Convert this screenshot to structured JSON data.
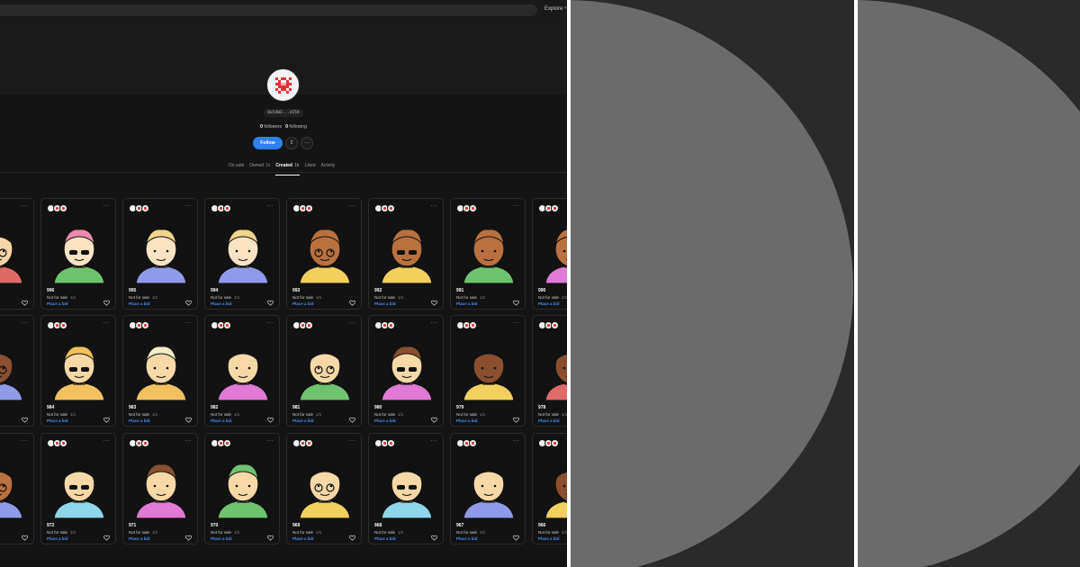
{
  "topbar": {
    "nav_explore": "Explore",
    "nav_more": "›"
  },
  "profile": {
    "address": "0x5403...d159",
    "followers_count": "0",
    "followers_label": "followers",
    "following_count": "0",
    "following_label": "following",
    "follow_label": "Follow",
    "share_glyph": "⇪",
    "more_glyph": "···"
  },
  "tabs": [
    {
      "label": "On sale",
      "count": ""
    },
    {
      "label": "Owned",
      "count": "1k"
    },
    {
      "label": "Created",
      "count": "1k"
    },
    {
      "label": "Liked",
      "count": ""
    },
    {
      "label": "Activity",
      "count": ""
    }
  ],
  "active_tab": "Created",
  "card_menu_glyph": "···",
  "card_sale_text": "Not for sale",
  "card_edition": "1/1",
  "card_bid_text": "Place a bid",
  "cards": [
    {
      "title": "",
      "skin": "#f5d6a8",
      "shirt": "#e06a6a",
      "hair": "#111111"
    },
    {
      "title": "996",
      "skin": "#fbe3c3",
      "shirt": "#6fc36e",
      "hair": "#f08ab0"
    },
    {
      "title": "995",
      "skin": "#fbe3c3",
      "shirt": "#8f9be8",
      "hair": "#f2d48a"
    },
    {
      "title": "994",
      "skin": "#fbe3c3",
      "shirt": "#8f9be8",
      "hair": "#f2d48a"
    },
    {
      "title": "993",
      "skin": "#b9713f",
      "shirt": "#f2d05e",
      "hair": "#b9713f"
    },
    {
      "title": "992",
      "skin": "#b9713f",
      "shirt": "#f2d05e",
      "hair": "#b9713f"
    },
    {
      "title": "991",
      "skin": "#b9713f",
      "shirt": "#6fc36e",
      "hair": "#b9713f"
    },
    {
      "title": "990",
      "skin": "#b9713f",
      "shirt": "#e07ad6",
      "hair": "#b9713f"
    },
    {
      "title": "",
      "skin": "#8a4f2e",
      "shirt": "#8f9be8",
      "hair": "#111111"
    },
    {
      "title": "984",
      "skin": "#f7d8a6",
      "shirt": "#f2c15e",
      "hair": "#f2c15e"
    },
    {
      "title": "983",
      "skin": "#f7d8a6",
      "shirt": "#f2c15e",
      "hair": "#f4ecc8"
    },
    {
      "title": "982",
      "skin": "#f7d8a6",
      "shirt": "#e07ad6",
      "hair": "#111111"
    },
    {
      "title": "981",
      "skin": "#f7d8a6",
      "shirt": "#6fc36e",
      "hair": "#111111"
    },
    {
      "title": "980",
      "skin": "#f7d8a6",
      "shirt": "#e07ad6",
      "hair": "#8a4f2e"
    },
    {
      "title": "979",
      "skin": "#8a4f2e",
      "shirt": "#f2d05e",
      "hair": "#111111"
    },
    {
      "title": "978",
      "skin": "#8a4f2e",
      "shirt": "#e06a6a",
      "hair": "#111111"
    },
    {
      "title": "",
      "skin": "#b9713f",
      "shirt": "#8f9be8",
      "hair": "#111111"
    },
    {
      "title": "972",
      "skin": "#f7d8a6",
      "shirt": "#8fd7e8",
      "hair": "#111111"
    },
    {
      "title": "971",
      "skin": "#f7d8a6",
      "shirt": "#e07ad6",
      "hair": "#8a4f2e"
    },
    {
      "title": "970",
      "skin": "#f7d8a6",
      "shirt": "#6fc36e",
      "hair": "#6fc36e"
    },
    {
      "title": "969",
      "skin": "#f7d8a6",
      "shirt": "#f2d05e",
      "hair": "#111111"
    },
    {
      "title": "968",
      "skin": "#f7d8a6",
      "shirt": "#8fd7e8",
      "hair": "#111111"
    },
    {
      "title": "967",
      "skin": "#f7d8a6",
      "shirt": "#8f9be8",
      "hair": "#111111"
    },
    {
      "title": "966",
      "skin": "#8a4f2e",
      "shirt": "#f2d05e",
      "hair": "#111111"
    }
  ],
  "colors": {
    "accent": "#2f7ff5",
    "placeholder_bg": "#2a2a2a",
    "placeholder_disc": "#6b6b6b"
  }
}
